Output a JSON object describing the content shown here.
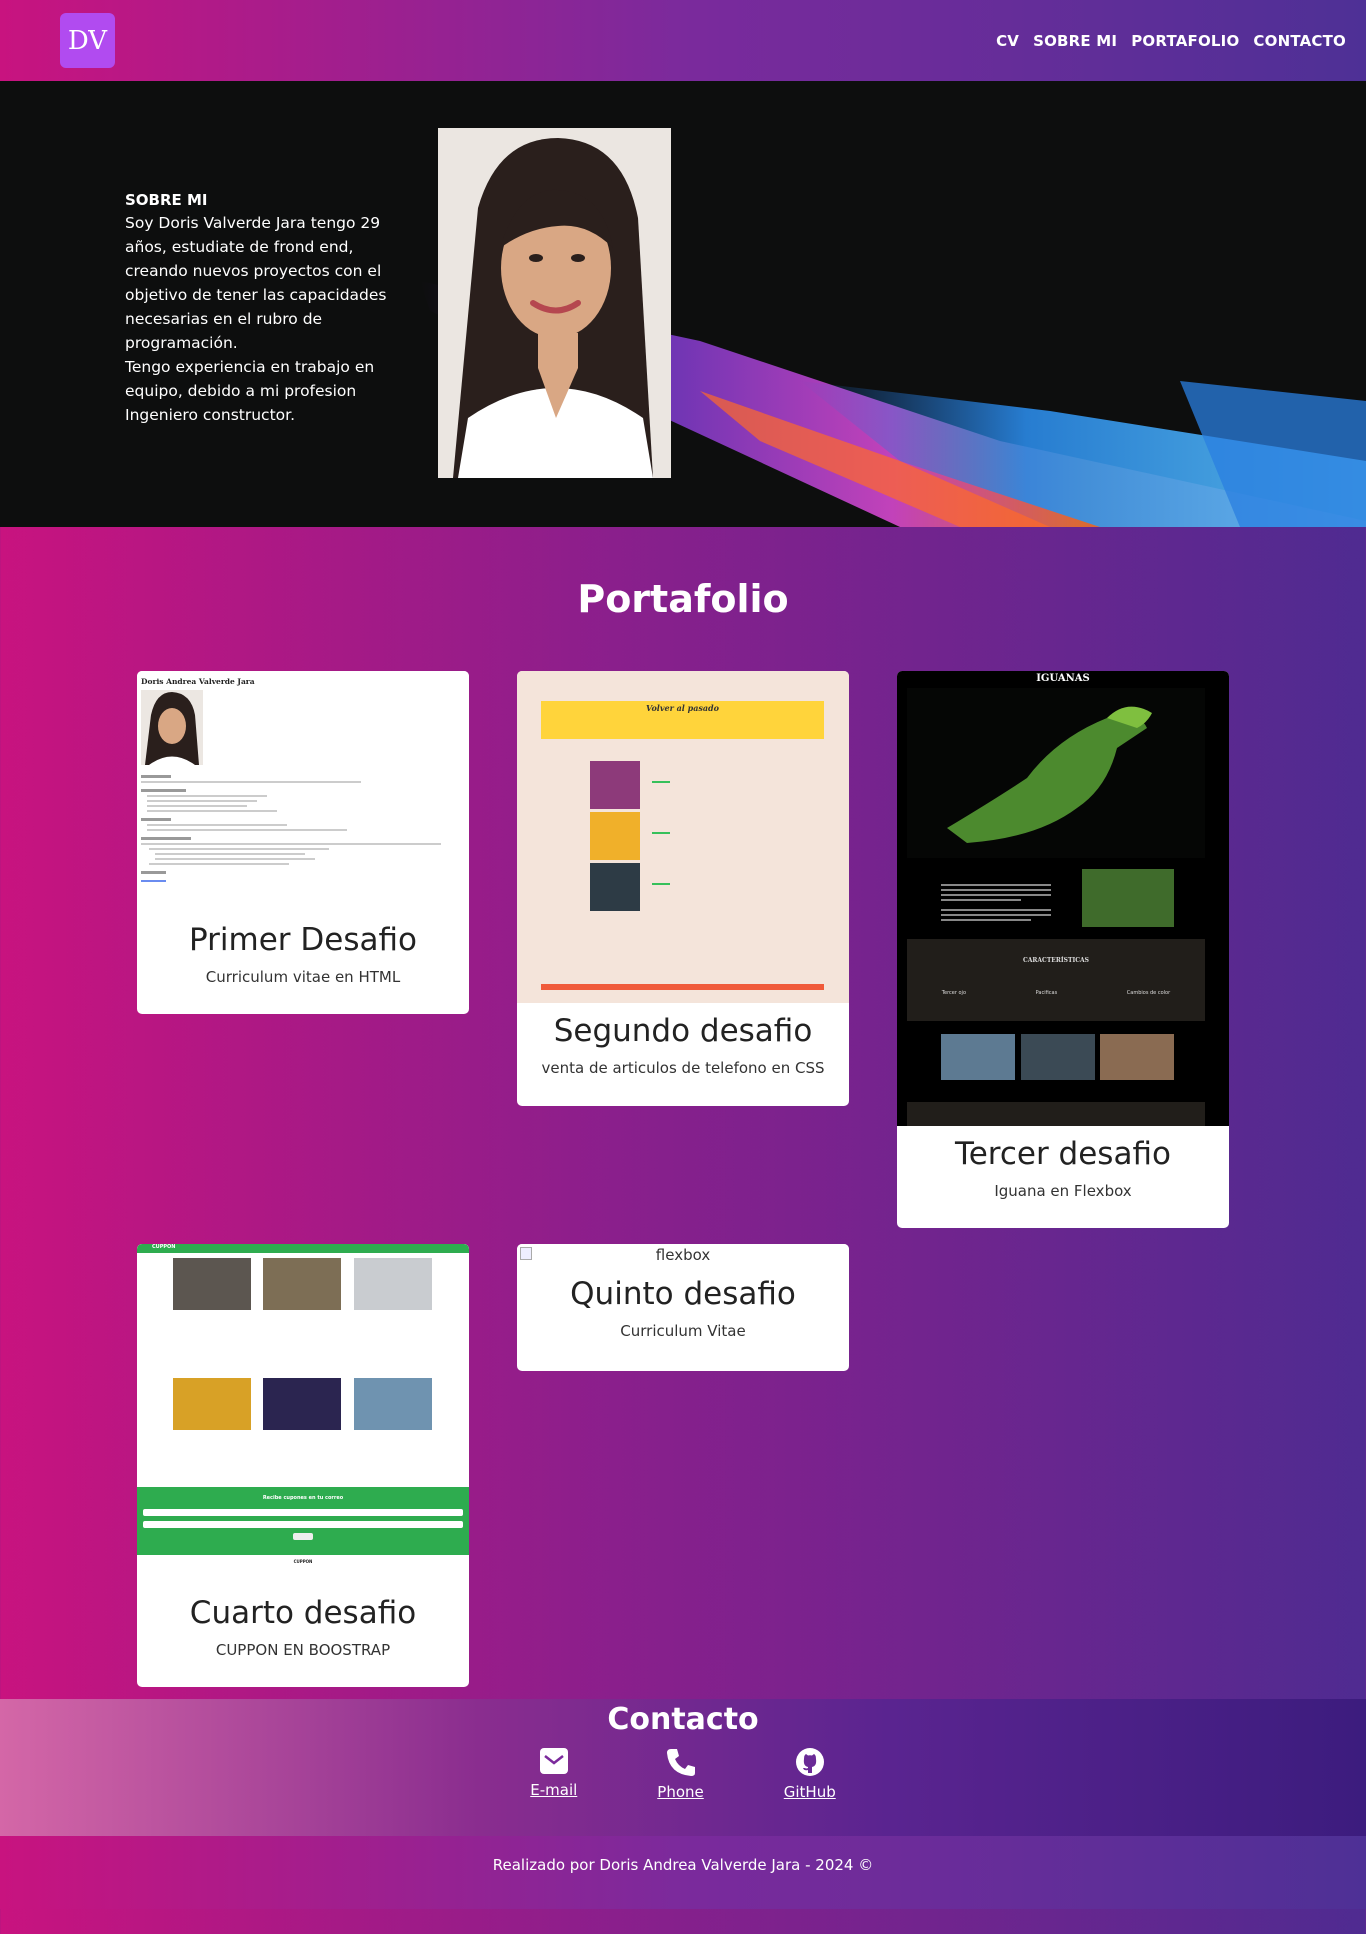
{
  "nav": {
    "logo": "DV",
    "links": [
      "CV",
      "SOBRE MI",
      "PORTAFOLIO",
      "CONTACTO"
    ]
  },
  "about": {
    "heading": "SOBRE MI",
    "text1": "Soy Doris Valverde Jara tengo 29 años, estudiate de frond end, creando nuevos proyectos con el objetivo de tener las capacidades necesarias en el rubro de programación.",
    "text2": "Tengo experiencia en trabajo en equipo, debido a mi profesion Ingeniero constructor."
  },
  "portfolio": {
    "title": "Portafolio",
    "cards": [
      {
        "title": "Primer Desafio",
        "subtitle": "Curriculum vitae en HTML",
        "thumb_title": "Doris Andrea Valverde Jara"
      },
      {
        "title": "Segundo desafio",
        "subtitle": "venta de articulos de telefono en CSS",
        "thumb_title": "Volver al pasado"
      },
      {
        "title": "Tercer desafio",
        "subtitle": "Iguana en Flexbox",
        "thumb_title": "IGUANAS",
        "thumb_features": "CARACTERÍSTICAS",
        "thumb_icons": [
          "Tercer ojo",
          "Pacificas",
          "Cambios de color"
        ]
      },
      {
        "title": "Cuarto desafio",
        "subtitle": "CUPPON EN BOOSTRAP",
        "thumb_brand": "CUPPON",
        "thumb_form": "Recibe cupones en tu correo",
        "thumb_footer": "CUPPON"
      },
      {
        "title": "Quinto desafio",
        "subtitle": "Curriculum Vitae",
        "broken_alt": "flexbox"
      }
    ]
  },
  "contact": {
    "title": "Contacto",
    "links": [
      "E-mail",
      "Phone",
      "GitHub"
    ]
  },
  "footer": {
    "text": "Realizado por Doris Andrea Valverde Jara - 2024 ©"
  }
}
